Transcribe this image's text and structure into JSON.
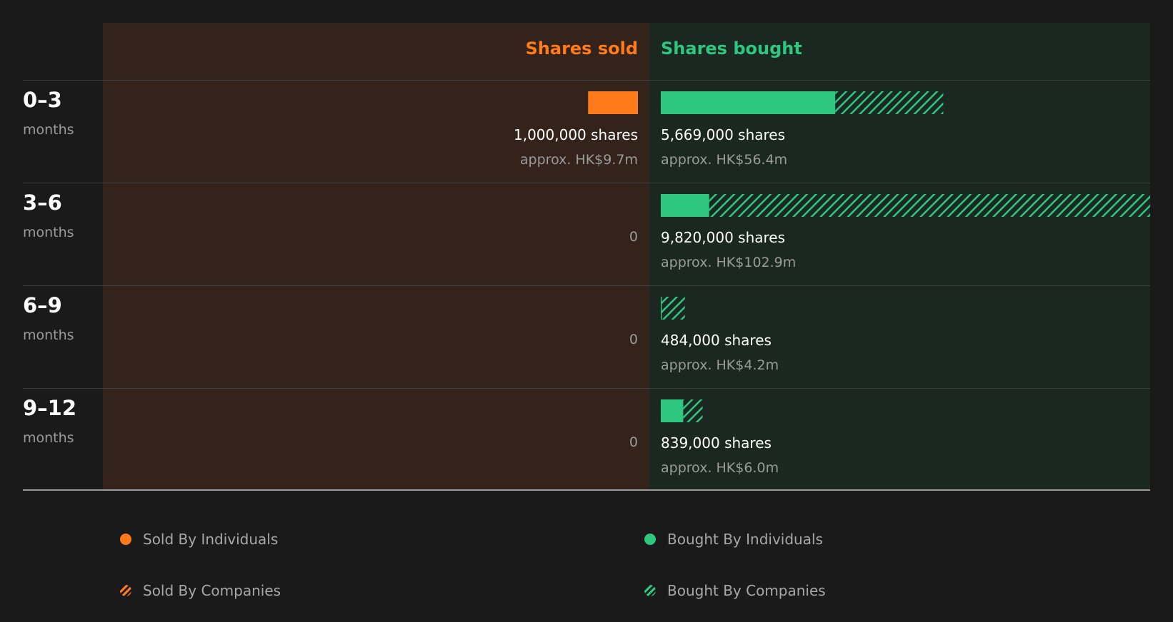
{
  "colors": {
    "sold": "#ff7a1a",
    "bought": "#2ec77f"
  },
  "chart_data": {
    "type": "bar",
    "orientation": "horizontal-diverging",
    "headers": {
      "sold": "Shares sold",
      "bought": "Shares bought"
    },
    "periods": [
      {
        "range": "0–3",
        "unit": "months",
        "sold_individuals": 1000000,
        "sold_companies": 0,
        "bought_individuals": 3500000,
        "bought_companies": 2169000,
        "sold_shares_label": "1,000,000 shares",
        "sold_approx_label": "approx. HK$9.7m",
        "sold_zero_label": "",
        "bought_shares_label": "5,669,000 shares",
        "bought_approx_label": "approx. HK$56.4m"
      },
      {
        "range": "3–6",
        "unit": "months",
        "sold_individuals": 0,
        "sold_companies": 0,
        "bought_individuals": 970000,
        "bought_companies": 8850000,
        "sold_shares_label": "",
        "sold_approx_label": "",
        "sold_zero_label": "0",
        "bought_shares_label": "9,820,000 shares",
        "bought_approx_label": "approx. HK$102.9m"
      },
      {
        "range": "6–9",
        "unit": "months",
        "sold_individuals": 0,
        "sold_companies": 0,
        "bought_individuals": 20000,
        "bought_companies": 464000,
        "sold_shares_label": "",
        "sold_approx_label": "",
        "sold_zero_label": "0",
        "bought_shares_label": "484,000 shares",
        "bought_approx_label": "approx. HK$4.2m"
      },
      {
        "range": "9–12",
        "unit": "months",
        "sold_individuals": 0,
        "sold_companies": 0,
        "bought_individuals": 450000,
        "bought_companies": 389000,
        "sold_shares_label": "",
        "sold_approx_label": "",
        "sold_zero_label": "0",
        "bought_shares_label": "839,000 shares",
        "bought_approx_label": "approx. HK$6.0m"
      }
    ],
    "max_bought_total": 9820000,
    "legend": [
      {
        "label": "Sold By Individuals",
        "kind": "sold",
        "pattern": "solid"
      },
      {
        "label": "Bought By Individuals",
        "kind": "bought",
        "pattern": "solid"
      },
      {
        "label": "Sold By Companies",
        "kind": "sold",
        "pattern": "hatched"
      },
      {
        "label": "Bought By Companies",
        "kind": "bought",
        "pattern": "hatched"
      }
    ]
  }
}
